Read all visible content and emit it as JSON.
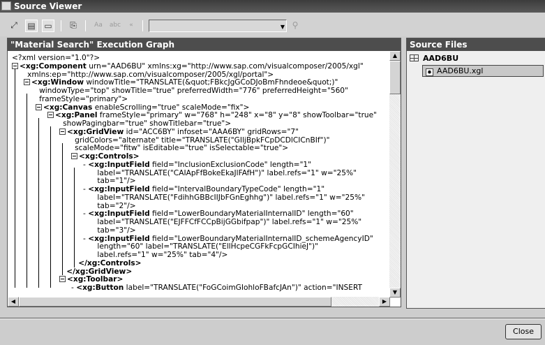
{
  "window": {
    "title": "Source Viewer"
  },
  "toolbar": {
    "buttons": [
      "expand-icon",
      "vertical-layout-icon",
      "horizontal-layout-icon",
      "copy-icon",
      "find-case-icon",
      "find-word-icon",
      "find-prev-icon",
      "find-icon"
    ],
    "search_value": ""
  },
  "left_panel": {
    "title": "\"Material Search\" Execution Graph",
    "lines": [
      {
        "lvl": 0,
        "box": false,
        "dash": false,
        "tag": "",
        "rest": "<?xml version=\"1.0\"?>"
      },
      {
        "lvl": 0,
        "box": true,
        "dash": false,
        "tag": "<xg:Component",
        "rest": " urn=\"AAD6BU\" xmlns:xg=\"http://www.sap.com/visualcomposer/2005/xgl\""
      },
      {
        "lvl": 1.3,
        "box": false,
        "dash": false,
        "tag": "",
        "rest": "xmlns:ep=\"http://www.sap.com/visualcomposer/2005/xgl/portal\">"
      },
      {
        "lvl": 1,
        "box": true,
        "dash": false,
        "tag": "<xg:Window",
        "rest": " windowTitle=\"TRANSLATE(&quot;FBkcJgGCoDJoBmFhndeoe&quot;)\""
      },
      {
        "lvl": 2.3,
        "box": false,
        "dash": false,
        "tag": "",
        "rest": "windowType=\"top\" showTitle=\"true\" preferredWidth=\"776\" preferredHeight=\"560\""
      },
      {
        "lvl": 2.3,
        "box": false,
        "dash": false,
        "tag": "",
        "rest": "frameStyle=\"primary\">"
      },
      {
        "lvl": 2,
        "box": true,
        "dash": false,
        "tag": "<xg:Canvas",
        "rest": " enableScrolling=\"true\" scaleMode=\"fix\">"
      },
      {
        "lvl": 3,
        "box": true,
        "dash": false,
        "tag": "<xg:Panel",
        "rest": " frameStyle=\"primary\" w=\"768\" h=\"248\" x=\"8\" y=\"8\" showToolbar=\"true\""
      },
      {
        "lvl": 4.3,
        "box": false,
        "dash": false,
        "tag": "",
        "rest": "showPagingbar=\"true\" showTitlebar=\"true\">"
      },
      {
        "lvl": 4,
        "box": true,
        "dash": false,
        "tag": "<xg:GridView",
        "rest": " id=\"ACC6BY\" infoset=\"AAA6BY\" gridRows=\"7\""
      },
      {
        "lvl": 5.3,
        "box": false,
        "dash": false,
        "tag": "",
        "rest": "gridColors=\"alternate\" title=\"TRANSLATE(\"GIljBpkFCpDCDlCICnBIf\")\""
      },
      {
        "lvl": 5.3,
        "box": false,
        "dash": false,
        "tag": "",
        "rest": "scaleMode=\"fitw\" isEditable=\"true\" isSelectable=\"true\">"
      },
      {
        "lvl": 5,
        "box": true,
        "dash": false,
        "tag": "<xg:Controls>",
        "rest": ""
      },
      {
        "lvl": 6,
        "box": false,
        "dash": true,
        "tag": "<xg:InputField",
        "rest": " field=\"InclusionExclusionCode\" length=\"1\""
      },
      {
        "lvl": 7.2,
        "box": false,
        "dash": false,
        "tag": "",
        "rest": "label=\"TRANSLATE(\"CAIApFfBokeEkaJlFAfH\")\" label.refs=\"1\" w=\"25%\""
      },
      {
        "lvl": 7.2,
        "box": false,
        "dash": false,
        "tag": "",
        "rest": "tab=\"1\"/>"
      },
      {
        "lvl": 6,
        "box": false,
        "dash": true,
        "tag": "<xg:InputField",
        "rest": " field=\"IntervalBoundaryTypeCode\" length=\"1\""
      },
      {
        "lvl": 7.2,
        "box": false,
        "dash": false,
        "tag": "",
        "rest": "label=\"TRANSLATE(\"FdihhGBBcIIJbFGnEghhg\")\" label.refs=\"1\" w=\"25%\""
      },
      {
        "lvl": 7.2,
        "box": false,
        "dash": false,
        "tag": "",
        "rest": "tab=\"2\"/>"
      },
      {
        "lvl": 6,
        "box": false,
        "dash": true,
        "tag": "<xg:InputField",
        "rest": " field=\"LowerBoundaryMaterialInternalID\" length=\"60\""
      },
      {
        "lvl": 7.2,
        "box": false,
        "dash": false,
        "tag": "",
        "rest": "label=\"TRANSLATE(\"EJFFCfFCCpBijGGbifpap\")\" label.refs=\"1\" w=\"25%\""
      },
      {
        "lvl": 7.2,
        "box": false,
        "dash": false,
        "tag": "",
        "rest": "tab=\"3\"/>"
      },
      {
        "lvl": 6,
        "box": false,
        "dash": true,
        "tag": "<xg:InputField",
        "rest": " field=\"LowerBoundaryMaterialInternalID_schemeAgencyID\""
      },
      {
        "lvl": 7.2,
        "box": false,
        "dash": false,
        "tag": "",
        "rest": "length=\"60\" label=\"TRANSLATE(\"EllHcpeCGFkFcpGCIhieJ\")\""
      },
      {
        "lvl": 7.2,
        "box": false,
        "dash": false,
        "tag": "",
        "rest": "label.refs=\"1\" w=\"25%\" tab=\"4\"/>"
      },
      {
        "lvl": 5.6,
        "box": false,
        "dash": false,
        "tag": "</xg:Controls>",
        "rest": ""
      },
      {
        "lvl": 4.6,
        "box": false,
        "dash": false,
        "tag": "</xg:GridView>",
        "rest": ""
      },
      {
        "lvl": 4,
        "box": true,
        "dash": false,
        "tag": "<xg:Toolbar>",
        "rest": ""
      },
      {
        "lvl": 5,
        "box": false,
        "dash": true,
        "tag": "<xg:Button",
        "rest": " label=\"TRANSLATE(\"FoGCoimGIohloFBafcJAn\")\" action=\"INSERT"
      }
    ]
  },
  "right_panel": {
    "title": "Source Files",
    "root": "AAD6BU",
    "file": "AAD6BU.xgl"
  },
  "footer": {
    "close_label": "Close"
  }
}
